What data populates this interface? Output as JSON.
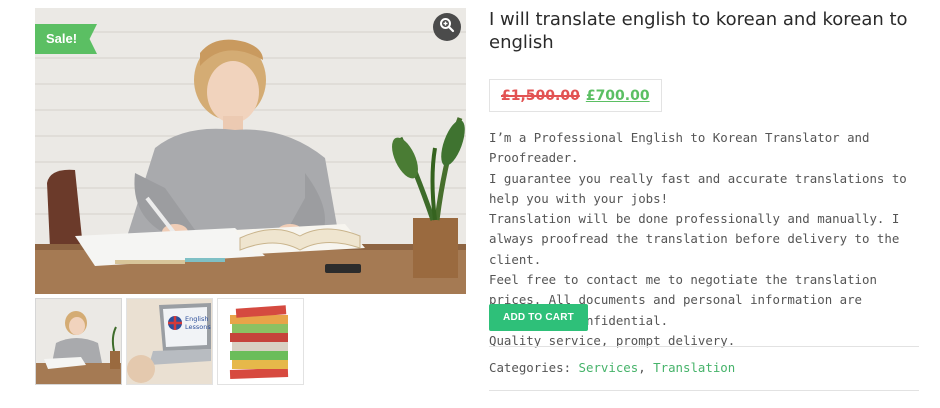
{
  "sale_badge": "Sale!",
  "product": {
    "title": "I will translate english to korean and korean to english",
    "old_price": "£1,500.00",
    "new_price": "£700.00",
    "description": [
      "I’m a Professional English to Korean Translator and Proofreader.",
      "I guarantee you really fast and accurate translations to help you with your jobs!",
      "Translation will be done professionally and manually. I always proofread the translation before delivery to the client.",
      "Feel free to contact me to negotiate the translation prices. All documents and personal information are absolutely confidential.",
      "Quality service, prompt delivery."
    ],
    "add_to_cart": "ADD TO CART"
  },
  "categories": {
    "label": "Categories:",
    "items": [
      "Services",
      "Translation"
    ],
    "separator": ","
  },
  "gallery": {
    "thumb_2_text": [
      "English",
      "Lessons"
    ],
    "zoom_icon": "magnifier-zoom-icon"
  },
  "colors": {
    "sale_green": "#5bbf63",
    "price_old": "#e25353",
    "price_new": "#5bbf63",
    "button_green": "#2ec079",
    "link_green": "#46b36a"
  }
}
